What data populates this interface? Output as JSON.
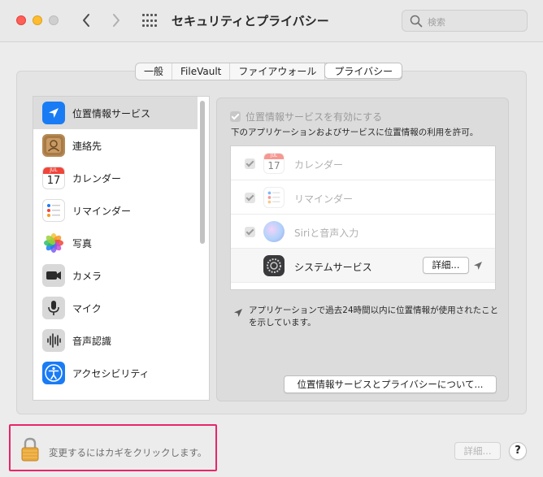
{
  "window": {
    "title": "セキュリティとプライバシー",
    "search_placeholder": "検索"
  },
  "tabs": [
    {
      "label": "一般",
      "active": false
    },
    {
      "label": "FileVault",
      "active": false
    },
    {
      "label": "ファイアウォール",
      "active": false
    },
    {
      "label": "プライバシー",
      "active": true
    }
  ],
  "sidebar": {
    "items": [
      {
        "label": "位置情報サービス",
        "icon": "location-arrow-icon",
        "selected": true
      },
      {
        "label": "連絡先",
        "icon": "contacts-icon"
      },
      {
        "label": "カレンダー",
        "icon": "calendar-icon"
      },
      {
        "label": "リマインダー",
        "icon": "reminders-icon"
      },
      {
        "label": "写真",
        "icon": "photos-icon"
      },
      {
        "label": "カメラ",
        "icon": "camera-icon"
      },
      {
        "label": "マイク",
        "icon": "microphone-icon"
      },
      {
        "label": "音声認識",
        "icon": "waveform-icon"
      },
      {
        "label": "アクセシビリティ",
        "icon": "accessibility-icon"
      }
    ]
  },
  "location": {
    "enable_label": "位置情報サービスを有効にする",
    "enabled": true,
    "allow_label": "下のアプリケーションおよびサービスに位置情報の利用を許可。",
    "apps": [
      {
        "name": "カレンダー",
        "icon": "calendar-icon",
        "checked": true
      },
      {
        "name": "リマインダー",
        "icon": "reminders-icon",
        "checked": true
      },
      {
        "name": "Siriと音声入力",
        "icon": "siri-icon",
        "checked": true
      },
      {
        "name": "システムサービス",
        "icon": "system-services-icon",
        "detail_label": "詳細..."
      }
    ],
    "calendar_icon_month": "JUL",
    "calendar_icon_day": "17",
    "note": "アプリケーションで過去24時間以内に位置情報が使用されたことを示しています。",
    "about_button": "位置情報サービスとプライバシーについて..."
  },
  "bottom": {
    "lock_text": "変更するにはカギをクリックします。",
    "detail_button": "詳細...",
    "help_label": "?"
  },
  "colors": {
    "highlight_border": "#e8256b",
    "location_blue": "#1a7cf5"
  }
}
